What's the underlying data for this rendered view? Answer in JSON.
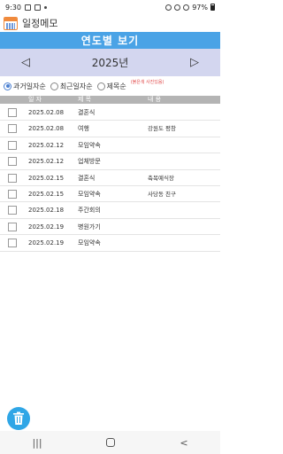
{
  "status": {
    "time": "9:30",
    "battery": "97%"
  },
  "app": {
    "title": "일정메모"
  },
  "banner": {
    "title": "연도별 보기"
  },
  "year": {
    "value": "2025년",
    "prev": "◁",
    "next": "▷"
  },
  "sort": {
    "options": [
      "과거일자순",
      "최근일자순",
      "제목순"
    ],
    "selected": 0,
    "note": "(붉은색 사진있음)"
  },
  "table": {
    "headers": {
      "date": "일 자",
      "title": "제 목",
      "content": "내 용"
    },
    "rows": [
      {
        "date": "2025.02.08",
        "title": "결혼식",
        "content": ""
      },
      {
        "date": "2025.02.08",
        "title": "여행",
        "content": "강원도 평창"
      },
      {
        "date": "2025.02.12",
        "title": "모임약속",
        "content": ""
      },
      {
        "date": "2025.02.12",
        "title": "업체방문",
        "content": ""
      },
      {
        "date": "2025.02.15",
        "title": "결혼식",
        "content": "축복예식장"
      },
      {
        "date": "2025.02.15",
        "title": "모임약속",
        "content": "사당동 친구"
      },
      {
        "date": "2025.02.18",
        "title": "주간회의",
        "content": ""
      },
      {
        "date": "2025.02.19",
        "title": "병원가기",
        "content": ""
      },
      {
        "date": "2025.02.19",
        "title": "모임약속",
        "content": ""
      }
    ]
  },
  "nav": {
    "recents": "|||",
    "home": "○",
    "back": "<"
  },
  "colors": {
    "accent": "#4aa3e6",
    "yearbar": "#d3d6ef",
    "header": "#b4b4b4",
    "fab": "#2fa6e6",
    "note": "#e04a4a"
  },
  "icons": {
    "fab": "trash-icon",
    "app": "calendar-icon"
  }
}
